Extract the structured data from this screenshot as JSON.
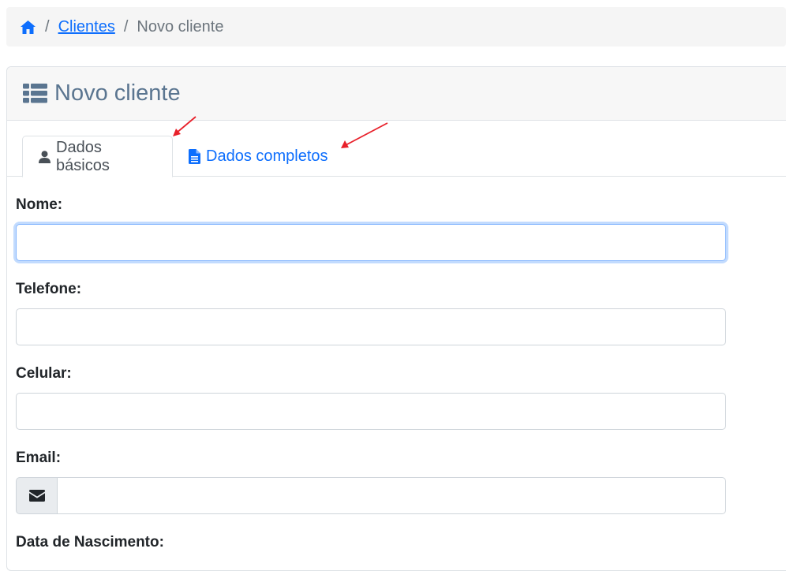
{
  "breadcrumb": {
    "home_icon": "home-icon",
    "separator": "/",
    "link_label": "Clientes",
    "current_label": "Novo cliente"
  },
  "card": {
    "title_icon": "list-icon",
    "title": "Novo cliente"
  },
  "tabs": [
    {
      "label": "Dados básicos",
      "icon": "user-icon",
      "active": true
    },
    {
      "label": "Dados completos",
      "icon": "file-text-icon",
      "active": false
    }
  ],
  "form": {
    "fields": [
      {
        "label": "Nome:",
        "value": "",
        "focused": true
      },
      {
        "label": "Telefone:",
        "value": ""
      },
      {
        "label": "Celular:",
        "value": ""
      },
      {
        "label": "Email:",
        "value": "",
        "addon_icon": "envelope-icon"
      },
      {
        "label": "Data de Nascimento:"
      }
    ]
  },
  "colors": {
    "link": "#0d6efd",
    "title": "#5a7590",
    "annotation_arrow": "#e8202a"
  }
}
